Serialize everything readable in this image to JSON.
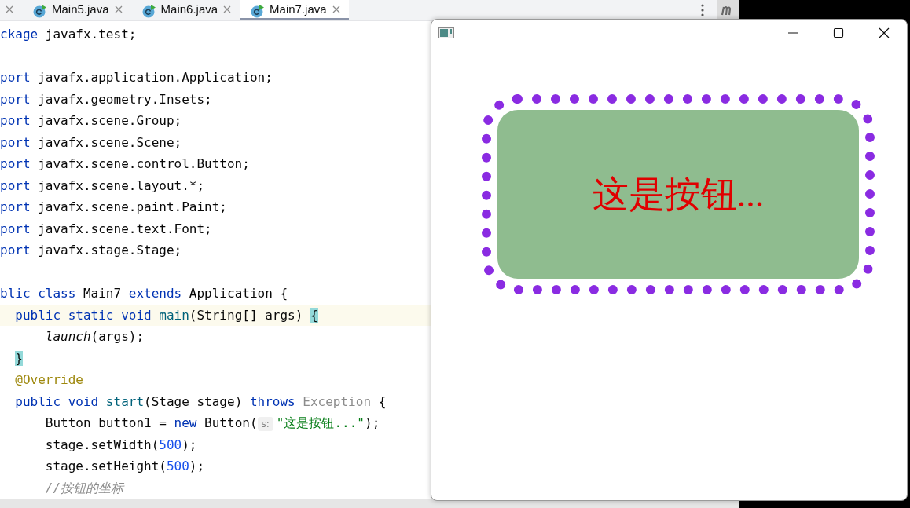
{
  "editor": {
    "tabs": [
      {
        "label": "Main5.java",
        "selected": false
      },
      {
        "label": "Main6.java",
        "selected": false
      },
      {
        "label": "Main7.java",
        "selected": true
      }
    ],
    "code_lines": [
      {
        "kind": "code",
        "tokens": [
          {
            "kind": "keyword",
            "text": "ckage"
          },
          {
            "kind": "plain",
            "text": " javafx.test;"
          }
        ]
      },
      {
        "kind": "blank"
      },
      {
        "kind": "code",
        "tokens": [
          {
            "kind": "keyword",
            "text": "port"
          },
          {
            "kind": "plain",
            "text": " javafx.application.Application;"
          }
        ]
      },
      {
        "tokens": [
          {
            "kind": "keyword",
            "text": "port"
          },
          {
            "kind": "plain",
            "text": " javafx.geometry.Insets;"
          }
        ]
      },
      {
        "tokens": [
          {
            "kind": "keyword",
            "text": "port"
          },
          {
            "kind": "plain",
            "text": " javafx.scene.Group;"
          }
        ]
      },
      {
        "tokens": [
          {
            "kind": "keyword",
            "text": "port"
          },
          {
            "kind": "plain",
            "text": " javafx.scene.Scene;"
          }
        ]
      },
      {
        "tokens": [
          {
            "kind": "keyword",
            "text": "port"
          },
          {
            "kind": "plain",
            "text": " javafx.scene.control.Button;"
          }
        ]
      },
      {
        "tokens": [
          {
            "kind": "keyword",
            "text": "port"
          },
          {
            "kind": "plain",
            "text": " javafx.scene.layout.*;"
          }
        ]
      },
      {
        "tokens": [
          {
            "kind": "keyword",
            "text": "port"
          },
          {
            "kind": "plain",
            "text": " javafx.scene.paint.Paint;"
          }
        ]
      },
      {
        "tokens": [
          {
            "kind": "keyword",
            "text": "port"
          },
          {
            "kind": "plain",
            "text": " javafx.scene.text.Font;"
          }
        ]
      },
      {
        "kind": "code",
        "tokens": [
          {
            "kind": "keyword",
            "text": "port"
          },
          {
            "kind": "plain",
            "text": " javafx.stage.Stage;"
          }
        ]
      },
      {
        "kind": "blank"
      },
      {
        "tokens": [
          {
            "kind": "keyword",
            "text": "blic class"
          },
          {
            "kind": "plain",
            "text": " Main7 "
          },
          {
            "kind": "keyword",
            "text": "extends"
          },
          {
            "kind": "plain",
            "text": " Application {"
          }
        ]
      },
      {
        "current": true,
        "tokens": [
          {
            "kind": "keyword",
            "text": "  public static void"
          },
          {
            "kind": "method",
            "text": " main"
          },
          {
            "kind": "plain",
            "text": "(String[] args) "
          },
          {
            "kind": "brace",
            "text": "{"
          }
        ]
      },
      {
        "current": false,
        "tokens": [
          {
            "kind": "italic",
            "text": "      launch"
          },
          {
            "kind": "plain",
            "text": "(args);"
          }
        ]
      },
      {
        "current": false,
        "indented": true,
        "tokens": [
          {
            "kind": "brace",
            "text": "}"
          }
        ]
      },
      {
        "current": false,
        "tokens": [
          {
            "kind": "annotation",
            "text": "  @Override"
          }
        ]
      },
      {
        "current": false,
        "tokens": [
          {
            "kind": "keyword",
            "text": "  public void"
          },
          {
            "kind": "method",
            "text": " start"
          },
          {
            "kind": "plain",
            "text": "(Stage stage) "
          },
          {
            "kind": "keyword",
            "text": "throws"
          },
          {
            "kind": "muted",
            "text": " Exception"
          },
          {
            "kind": "plain",
            "text": " {"
          }
        ]
      },
      {
        "current": false,
        "tokens": [
          {
            "kind": "plain",
            "text": "      Button button1 = "
          },
          {
            "kind": "keyword",
            "text": "new"
          },
          {
            "kind": "plain",
            "text": " Button("
          },
          {
            "kind": "hint",
            "text": "s:"
          },
          {
            "kind": "string",
            "text": "\"这是按钮...\""
          },
          {
            "kind": "plain",
            "text": ");"
          }
        ]
      },
      {
        "current": false,
        "tokens": [
          {
            "kind": "plain",
            "text": "      stage.setWidth("
          },
          {
            "kind": "number",
            "text": "500"
          },
          {
            "kind": "plain",
            "text": ");"
          }
        ]
      },
      {
        "current": false,
        "tokens": [
          {
            "kind": "plain",
            "text": "      stage.setHeight("
          },
          {
            "kind": "number",
            "text": "500"
          },
          {
            "kind": "plain",
            "text": ");"
          }
        ]
      },
      {
        "current": false,
        "tokens": [
          {
            "kind": "comment",
            "text": "      //按钮的坐标"
          }
        ]
      }
    ]
  },
  "app_window": {
    "button": {
      "label": "这是按钮..."
    }
  }
}
